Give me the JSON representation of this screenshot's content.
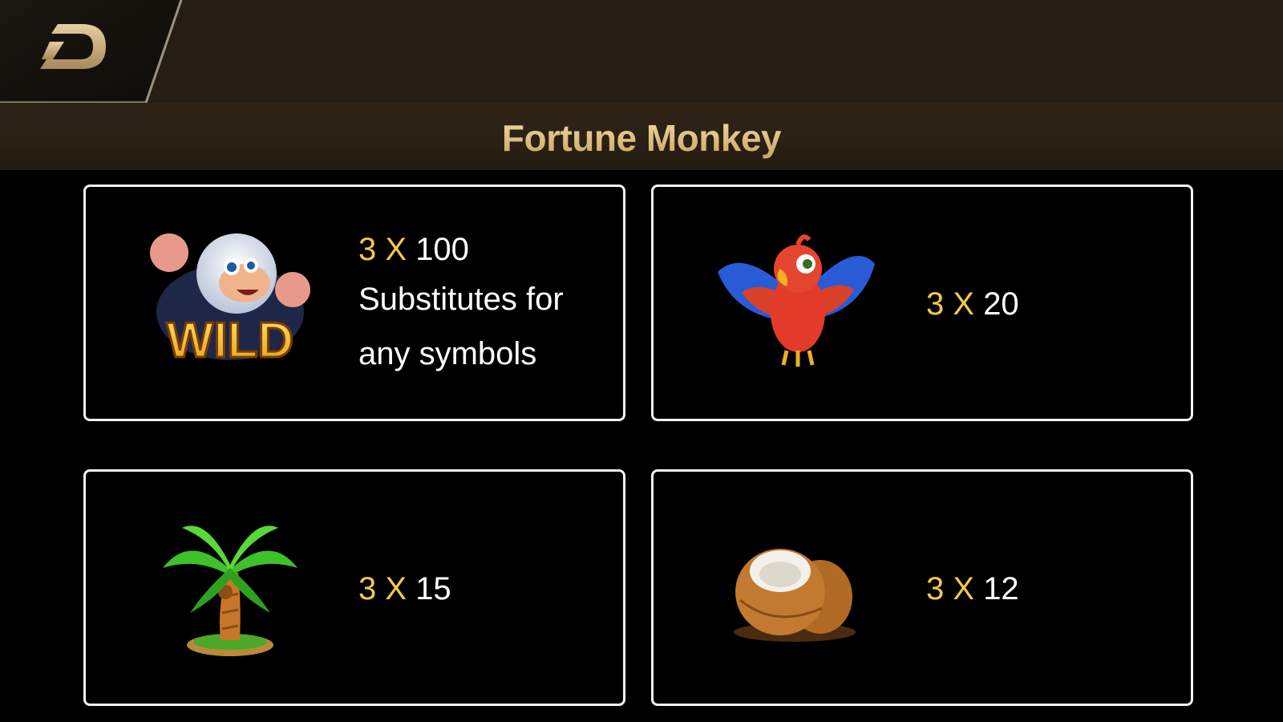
{
  "header": {
    "back_icon": "back-arrow-icon",
    "title": "Fortune Monkey"
  },
  "colors": {
    "gold": "#f5c84a",
    "title_gold": "#e8c98a",
    "topbar": "#241e15",
    "card_border": "#f2f2f2"
  },
  "paytable": [
    {
      "symbol": "wild-monkey-icon",
      "count": "3",
      "x": "X",
      "payout": "100",
      "description_line1": "Substitutes for",
      "description_line2": "any symbols",
      "wild_label": "WILD"
    },
    {
      "symbol": "parrot-icon",
      "count": "3",
      "x": "X",
      "payout": "20"
    },
    {
      "symbol": "palm-tree-icon",
      "count": "3",
      "x": "X",
      "payout": "15"
    },
    {
      "symbol": "coconut-icon",
      "count": "3",
      "x": "X",
      "payout": "12"
    }
  ]
}
